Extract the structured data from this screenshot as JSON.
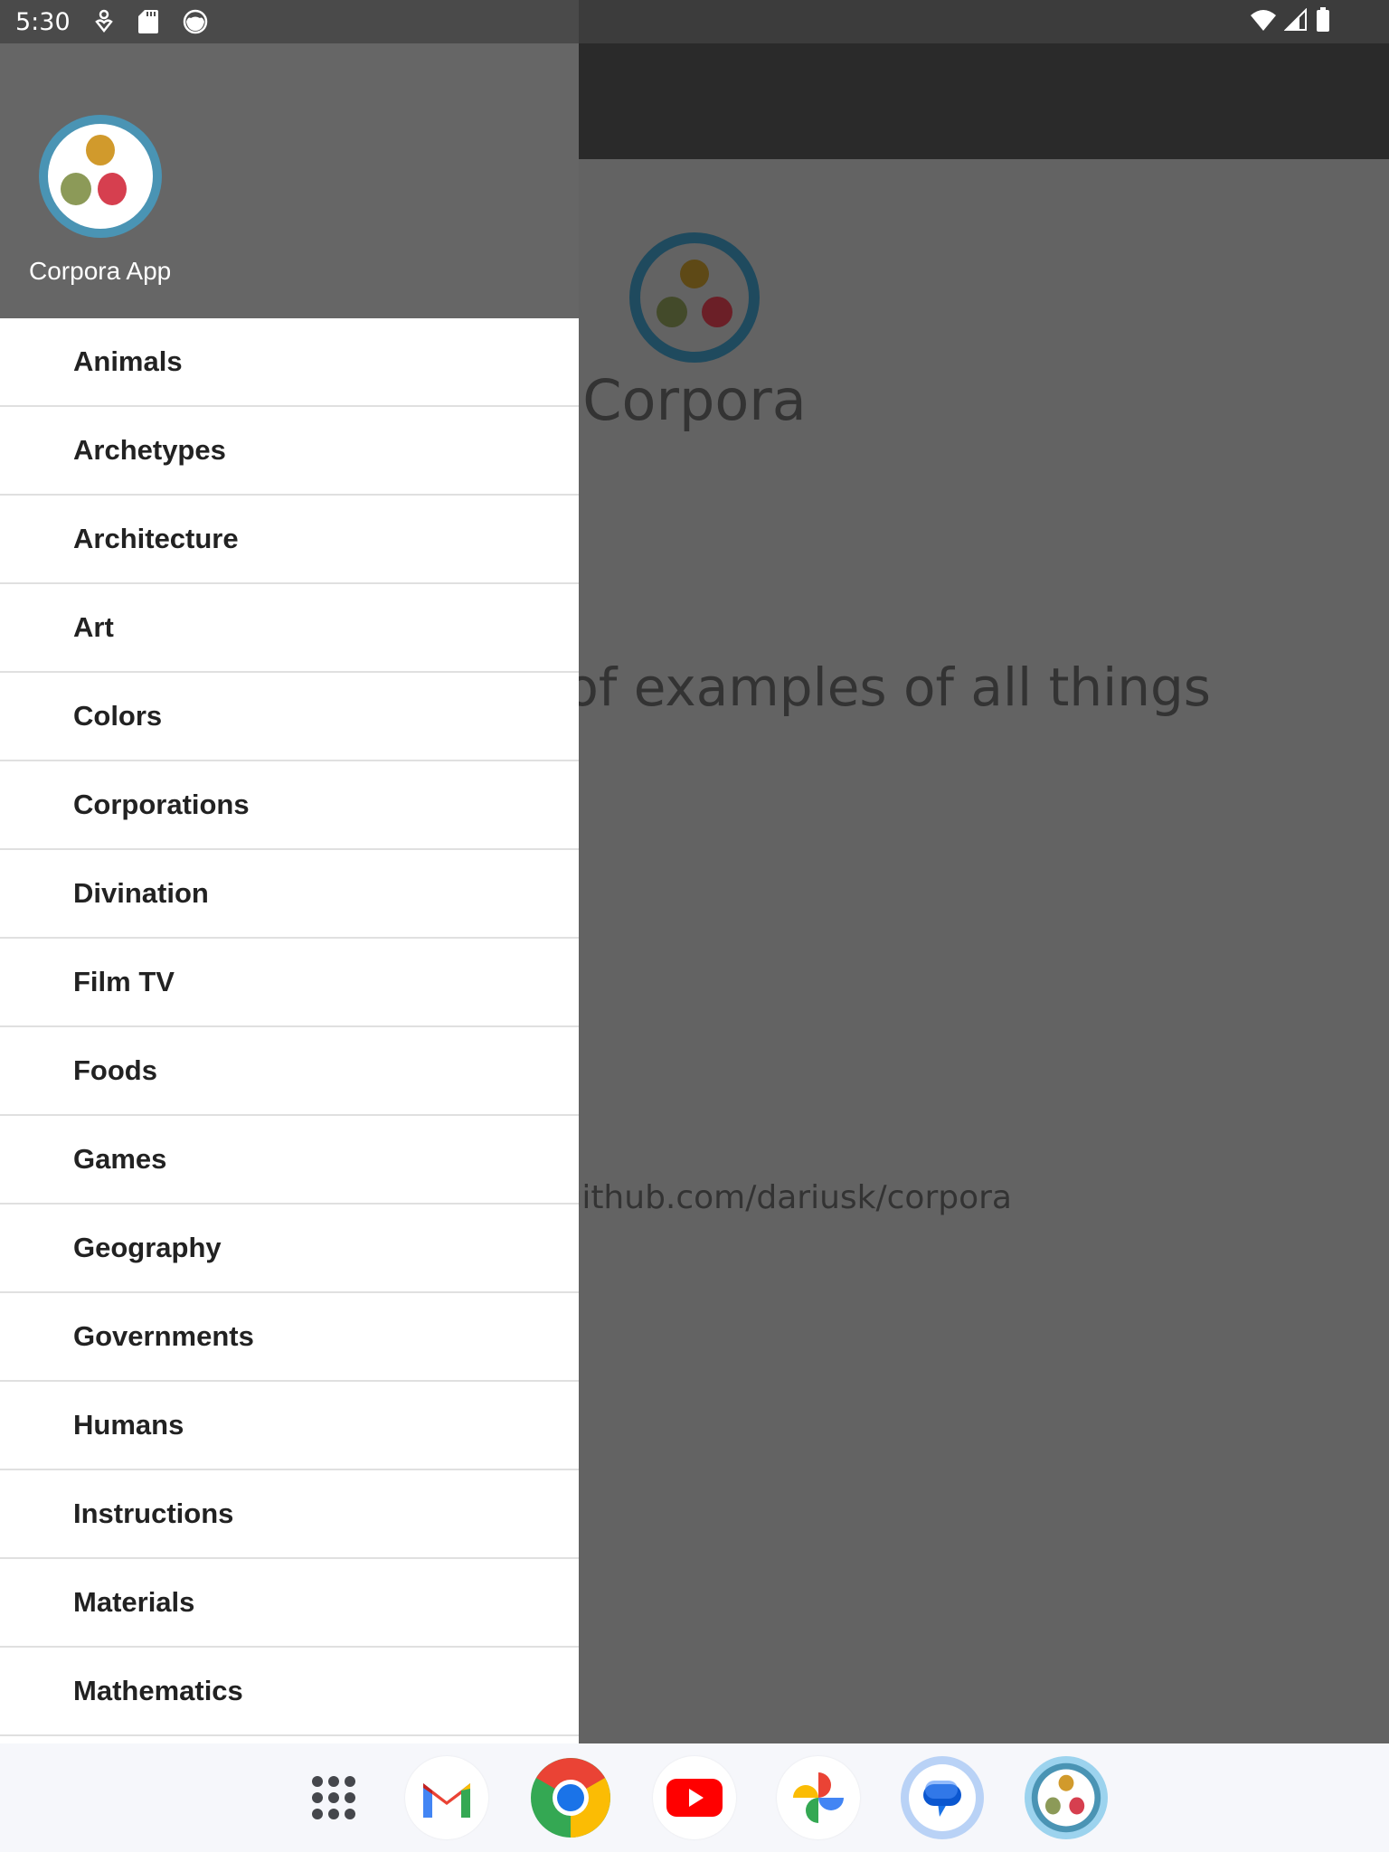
{
  "status_bar": {
    "time": "5:30",
    "left_icons": [
      "accessibility-icon",
      "sd-card-icon",
      "cat-face-icon"
    ],
    "right_icons": [
      "wifi-icon",
      "cell-signal-icon",
      "battery-icon"
    ]
  },
  "main": {
    "title": "Corpora",
    "subtitle": "A corpora of examples of all things",
    "link": "https://github.com/dariusk/corpora"
  },
  "drawer": {
    "app_name": "Corpora App",
    "items": [
      {
        "label": "Animals"
      },
      {
        "label": "Archetypes"
      },
      {
        "label": "Architecture"
      },
      {
        "label": "Art"
      },
      {
        "label": "Colors"
      },
      {
        "label": "Corporations"
      },
      {
        "label": "Divination"
      },
      {
        "label": "Film TV"
      },
      {
        "label": "Foods"
      },
      {
        "label": "Games"
      },
      {
        "label": "Geography"
      },
      {
        "label": "Governments"
      },
      {
        "label": "Humans"
      },
      {
        "label": "Instructions"
      },
      {
        "label": "Materials"
      },
      {
        "label": "Mathematics"
      }
    ]
  },
  "taskbar": {
    "apps": [
      "app-drawer",
      "Gmail",
      "Chrome",
      "YouTube",
      "Photos",
      "Messages",
      "Corpora App"
    ]
  },
  "colors": {
    "logo_ring": "#4a94b4",
    "dot_orange": "#d19a2c",
    "dot_green": "#8c9a58",
    "dot_red": "#d63f4f",
    "scrim": "#636363"
  }
}
